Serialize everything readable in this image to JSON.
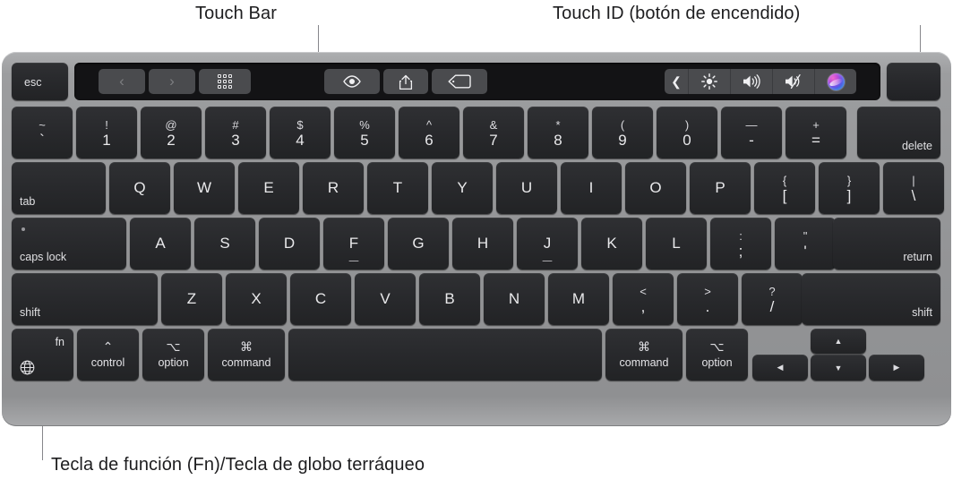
{
  "annotations": {
    "touch_bar": "Touch Bar",
    "touch_id": "Touch ID (botón de encendido)",
    "fn_globe": "Tecla de función (Fn)/Tecla de globo terráqueo"
  },
  "touch_bar": {
    "esc_label": "esc",
    "left_controls": [
      {
        "name": "back-button",
        "icon": "chevron-left-icon",
        "glyph": "‹"
      },
      {
        "name": "forward-button",
        "icon": "chevron-right-icon",
        "glyph": "›"
      },
      {
        "name": "grid-view-button",
        "icon": "grid-icon",
        "glyph": ""
      }
    ],
    "center_controls": [
      {
        "name": "quick-look-button",
        "icon": "eye-icon"
      },
      {
        "name": "share-button",
        "icon": "share-icon"
      },
      {
        "name": "tag-button",
        "icon": "tag-icon"
      }
    ],
    "right_controls": [
      {
        "name": "expand-control-strip-button",
        "icon": "chevron-left-icon",
        "glyph": "❮"
      },
      {
        "name": "brightness-button",
        "icon": "brightness-icon"
      },
      {
        "name": "volume-button",
        "icon": "volume-up-icon"
      },
      {
        "name": "mute-button",
        "icon": "volume-mute-icon"
      },
      {
        "name": "siri-button",
        "icon": "siri-icon"
      }
    ]
  },
  "touch_id": {
    "label": ""
  },
  "rows": {
    "number_row": [
      {
        "name": "key-backtick",
        "upper": "~",
        "lower": "`"
      },
      {
        "name": "key-1",
        "upper": "!",
        "lower": "1"
      },
      {
        "name": "key-2",
        "upper": "@",
        "lower": "2"
      },
      {
        "name": "key-3",
        "upper": "#",
        "lower": "3"
      },
      {
        "name": "key-4",
        "upper": "$",
        "lower": "4"
      },
      {
        "name": "key-5",
        "upper": "%",
        "lower": "5"
      },
      {
        "name": "key-6",
        "upper": "^",
        "lower": "6"
      },
      {
        "name": "key-7",
        "upper": "&",
        "lower": "7"
      },
      {
        "name": "key-8",
        "upper": "*",
        "lower": "8"
      },
      {
        "name": "key-9",
        "upper": "(",
        "lower": "9"
      },
      {
        "name": "key-0",
        "upper": ")",
        "lower": "0"
      },
      {
        "name": "key-minus",
        "upper": "—",
        "lower": "-"
      },
      {
        "name": "key-equal",
        "upper": "+",
        "lower": "="
      }
    ],
    "delete_label": "delete",
    "tab_label": "tab",
    "top_row": [
      {
        "name": "key-q",
        "label": "Q"
      },
      {
        "name": "key-w",
        "label": "W"
      },
      {
        "name": "key-e",
        "label": "E"
      },
      {
        "name": "key-r",
        "label": "R"
      },
      {
        "name": "key-t",
        "label": "T"
      },
      {
        "name": "key-y",
        "label": "Y"
      },
      {
        "name": "key-u",
        "label": "U"
      },
      {
        "name": "key-i",
        "label": "I"
      },
      {
        "name": "key-o",
        "label": "O"
      },
      {
        "name": "key-p",
        "label": "P"
      }
    ],
    "top_row_punct": [
      {
        "name": "key-bracket-left",
        "upper": "{",
        "lower": "["
      },
      {
        "name": "key-bracket-right",
        "upper": "}",
        "lower": "]"
      },
      {
        "name": "key-backslash",
        "upper": "|",
        "lower": "\\"
      }
    ],
    "caps_lock_label": "caps lock",
    "home_row": [
      {
        "name": "key-a",
        "label": "A",
        "homing": false
      },
      {
        "name": "key-s",
        "label": "S",
        "homing": false
      },
      {
        "name": "key-d",
        "label": "D",
        "homing": false
      },
      {
        "name": "key-f",
        "label": "F",
        "homing": true
      },
      {
        "name": "key-g",
        "label": "G",
        "homing": false
      },
      {
        "name": "key-h",
        "label": "H",
        "homing": false
      },
      {
        "name": "key-j",
        "label": "J",
        "homing": true
      },
      {
        "name": "key-k",
        "label": "K",
        "homing": false
      },
      {
        "name": "key-l",
        "label": "L",
        "homing": false
      }
    ],
    "home_row_punct": [
      {
        "name": "key-semicolon",
        "upper": ":",
        "lower": ";"
      },
      {
        "name": "key-quote",
        "upper": "\"",
        "lower": "'"
      }
    ],
    "return_label": "return",
    "shift_left_label": "shift",
    "bottom_letters": [
      {
        "name": "key-z",
        "label": "Z"
      },
      {
        "name": "key-x",
        "label": "X"
      },
      {
        "name": "key-c",
        "label": "C"
      },
      {
        "name": "key-v",
        "label": "V"
      },
      {
        "name": "key-b",
        "label": "B"
      },
      {
        "name": "key-n",
        "label": "N"
      },
      {
        "name": "key-m",
        "label": "M"
      }
    ],
    "bottom_punct": [
      {
        "name": "key-comma",
        "upper": "<",
        "lower": ","
      },
      {
        "name": "key-period",
        "upper": ">",
        "lower": "."
      },
      {
        "name": "key-slash",
        "upper": "?",
        "lower": "/"
      }
    ],
    "shift_right_label": "shift",
    "modifier_row": {
      "fn_label": "fn",
      "control": {
        "sym": "⌃",
        "word": "control"
      },
      "option_left": {
        "sym": "⌥",
        "word": "option"
      },
      "command_left": {
        "sym": "⌘",
        "word": "command"
      },
      "space": "",
      "command_right": {
        "sym": "⌘",
        "word": "command"
      },
      "option_right": {
        "sym": "⌥",
        "word": "option"
      },
      "arrows": {
        "left": "◀",
        "up": "▲",
        "down": "▼",
        "right": "▶"
      }
    }
  },
  "colors": {
    "body": "#949597",
    "key": "#313235",
    "key_text": "#e9e9eb",
    "touchbar_bg": "#131315",
    "touchbar_button": "#4a4b4e",
    "annotation_text": "#1d1d1f",
    "leader_line": "#86868b"
  }
}
